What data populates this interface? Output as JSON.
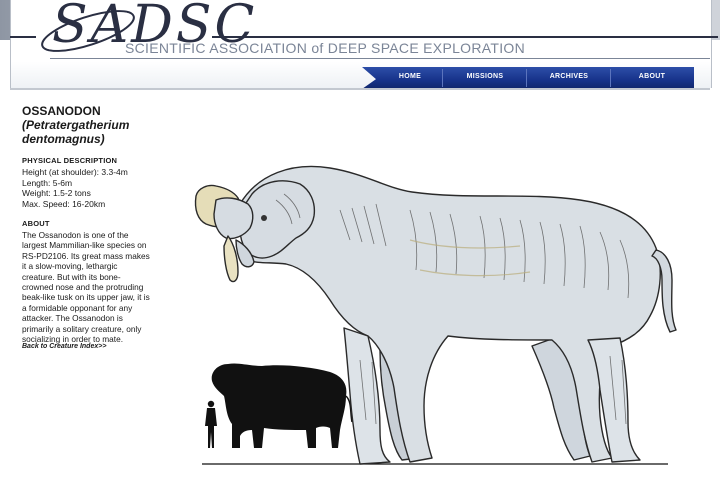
{
  "site": {
    "logo_text": "SADSC",
    "tagline": "SCIENTIFIC ASSOCIATION of DEEP SPACE EXPLORATION"
  },
  "nav": {
    "items": [
      {
        "label": "HOME"
      },
      {
        "label": "MISSIONS"
      },
      {
        "label": "ARCHIVES"
      },
      {
        "label": "ABOUT"
      }
    ]
  },
  "creature": {
    "name": "OSSANODON",
    "scientific_name_line1": "(Petratergatherium",
    "scientific_name_line2": "dentomagnus)",
    "physical_heading": "PHYSICAL DESCRIPTION",
    "stats": [
      "Height (at shoulder): 3.3-4m",
      "Length: 5-6m",
      "Weight: 1.5-2 tons",
      "Max. Speed: 16-20km"
    ],
    "about_heading": "ABOUT",
    "about_lines": [
      "The Ossanodon is one of the",
      "largest Mammilian-like species on",
      "RS-PD2106. Its great mass makes",
      "it a slow-moving, lethargic",
      "creature. But with its bone-",
      "crowned nose and the protruding",
      "beak-like tusk on its upper jaw, it is",
      "a formidable opponant for any",
      "attacker. The Ossanodon is",
      "primarily a solitary creature, only",
      "socializing in order to mate."
    ]
  },
  "links": {
    "back": "Back to Creature Index>>"
  },
  "colors": {
    "nav_blue": "#17338a",
    "logo_dark": "#2a2f43",
    "tagline_gray": "#7b8597",
    "creature_body": "#d9dfe4"
  }
}
